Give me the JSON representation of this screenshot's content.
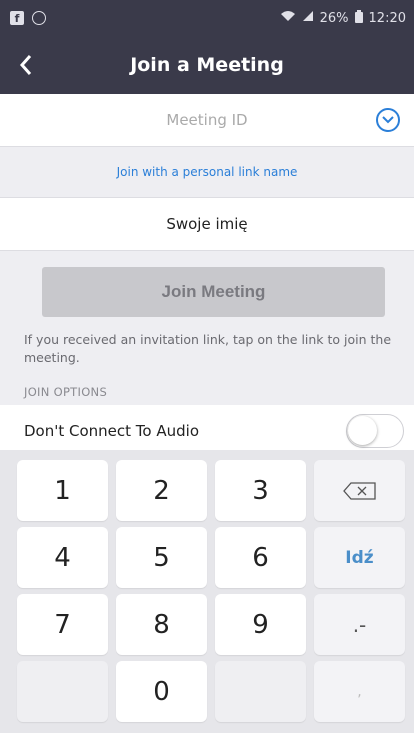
{
  "status_bar": {
    "battery": "26%",
    "time": "12:20"
  },
  "header": {
    "title": "Join a Meeting"
  },
  "meeting_id": {
    "placeholder": "Meeting ID",
    "value": ""
  },
  "personal_link": {
    "label": "Join with a personal link name"
  },
  "name_field": {
    "value": "Swoje imię"
  },
  "join_button": {
    "label": "Join Meeting"
  },
  "info_text": "If you received an invitation link, tap on the link to join the meeting.",
  "join_options": {
    "label": "JOIN OPTIONS",
    "audio_label": "Don't Connect To Audio",
    "audio_toggle": false
  },
  "keyboard": {
    "rows": [
      [
        "1",
        "2",
        "3",
        "⌫"
      ],
      [
        "4",
        "5",
        "6",
        "Idź"
      ],
      [
        "7",
        "8",
        "9",
        ".-"
      ],
      [
        "",
        "0",
        "",
        ","
      ]
    ]
  },
  "colors": {
    "header_bg": "#3a3a4a",
    "accent": "#2b7fd8"
  }
}
